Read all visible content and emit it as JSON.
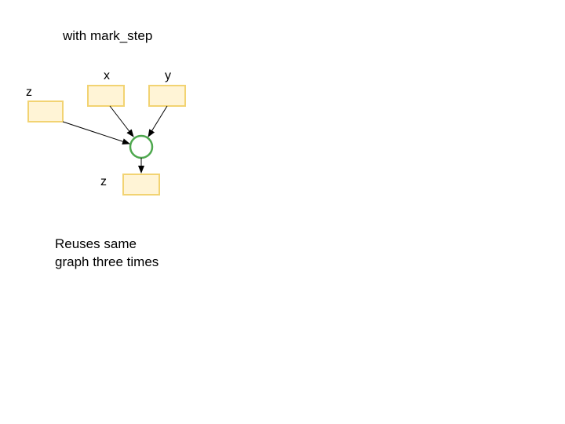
{
  "title": "with mark_step",
  "labels": {
    "x": "x",
    "y": "y",
    "z_top": "z",
    "z_bottom": "z"
  },
  "op": "+",
  "caption": "Reuses same\ngraph three times",
  "colors": {
    "box_fill": "#fff4d6",
    "box_stroke": "#f2d372",
    "op_stroke": "#4ea84e",
    "arrow": "#000000"
  }
}
